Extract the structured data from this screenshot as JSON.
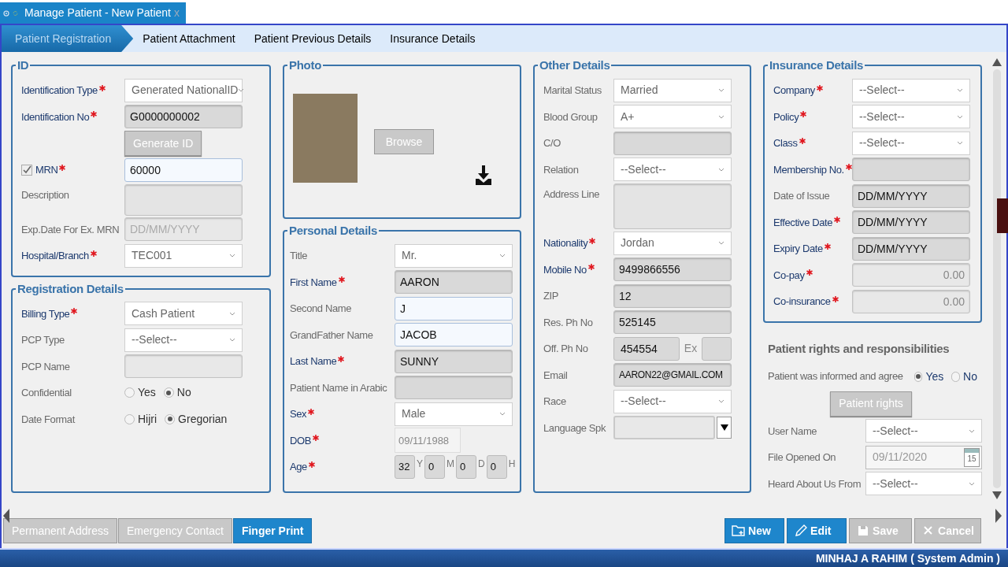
{
  "window_tab": {
    "title": "Manage Patient - New Patient",
    "close": "x"
  },
  "tabs": [
    {
      "label": "Patient Registration",
      "selected": true
    },
    {
      "label": "Patient Attachment",
      "selected": false
    },
    {
      "label": "Patient Previous Details",
      "selected": false
    },
    {
      "label": "Insurance Details",
      "selected": false
    }
  ],
  "columns": [
    [
      {
        "kind": "fieldset",
        "legend": "ID",
        "rows": [
          {
            "kind": "select",
            "label": "Identification Type",
            "required": true,
            "value": "Generated NationalID"
          },
          {
            "kind": "filled",
            "label": "Identification No",
            "required": true,
            "value": "G0000000002"
          },
          {
            "kind": "button",
            "label": "Generate ID"
          },
          {
            "kind": "editable",
            "label": "MRN",
            "required": true,
            "checked": true,
            "value": "60000"
          },
          {
            "kind": "textarea",
            "label": "Description",
            "required": false
          },
          {
            "kind": "disabled",
            "label": "Exp.Date For Ex. MRN",
            "required": false,
            "placeholder": "DD/MM/YYYY"
          },
          {
            "kind": "select",
            "label": "Hospital/Branch",
            "required": true,
            "value": "TEC001"
          }
        ]
      },
      {
        "kind": "fieldset",
        "legend": "Registration Details",
        "rows": [
          {
            "kind": "select",
            "label": "Billing Type",
            "required": true,
            "value": "Cash Patient"
          },
          {
            "kind": "select",
            "label": "PCP Type",
            "required": false,
            "value": "--Select--"
          },
          {
            "kind": "disabled",
            "label": "PCP Name",
            "required": false
          },
          {
            "kind": "radio",
            "label": "Confidential",
            "required": false,
            "options": [
              {
                "label": "Yes",
                "selected": false
              },
              {
                "label": "No",
                "selected": true
              }
            ]
          },
          {
            "kind": "radio",
            "label": "Date Format",
            "required": false,
            "options": [
              {
                "label": "Hijri",
                "selected": false
              },
              {
                "label": "Gregorian",
                "selected": true
              }
            ]
          }
        ]
      }
    ],
    [
      {
        "kind": "photo",
        "legend": "Photo",
        "browse": "Browse"
      },
      {
        "kind": "fieldset",
        "legend": "Personal Details",
        "rows": [
          {
            "kind": "select",
            "label": "Title",
            "required": false,
            "value": "Mr."
          },
          {
            "kind": "filled",
            "label": "First Name",
            "required": true,
            "value": "AARON"
          },
          {
            "kind": "editable",
            "label": "Second Name",
            "required": false,
            "value": "J"
          },
          {
            "kind": "editable",
            "label": "GrandFather Name",
            "required": false,
            "value": "JACOB"
          },
          {
            "kind": "filled",
            "label": "Last Name",
            "required": true,
            "value": "SUNNY"
          },
          {
            "kind": "filled",
            "label": "Patient Name in Arabic",
            "required": false
          },
          {
            "kind": "select",
            "label": "Sex",
            "required": true,
            "value": "Male"
          },
          {
            "kind": "date",
            "label": "DOB",
            "required": true,
            "value": "09/11/1988"
          },
          {
            "kind": "age",
            "label": "Age",
            "required": true,
            "parts": [
              {
                "value": "32",
                "unit": "Y"
              },
              {
                "value": "0",
                "unit": "M"
              },
              {
                "value": "0",
                "unit": "D"
              },
              {
                "value": "0",
                "unit": "H"
              }
            ]
          }
        ]
      }
    ],
    [
      {
        "kind": "fieldset",
        "legend": "Other Details",
        "rows": [
          {
            "kind": "select",
            "label": "Marital Status",
            "required": false,
            "value": "Married"
          },
          {
            "kind": "select",
            "label": "Blood Group",
            "required": false,
            "value": "A+"
          },
          {
            "kind": "filled",
            "label": "C/O",
            "required": false
          },
          {
            "kind": "select",
            "label": "Relation",
            "required": false,
            "value": "--Select--"
          },
          {
            "kind": "textarea",
            "label": "Address Line",
            "required": false
          },
          {
            "kind": "select",
            "label": "Nationality",
            "required": true,
            "value": "Jordan"
          },
          {
            "kind": "filled",
            "label": "Mobile No",
            "required": true,
            "value": "9499866556"
          },
          {
            "kind": "filled",
            "label": "ZIP",
            "required": false,
            "value": "12"
          },
          {
            "kind": "filled",
            "label": "Res. Ph No",
            "required": false,
            "value": "525145"
          },
          {
            "kind": "phone",
            "label": "Off. Ph No",
            "required": false,
            "value": "454554",
            "ext_label": "Ex"
          },
          {
            "kind": "email",
            "label": "Email",
            "required": false,
            "value": "AARON22@GMAIL.COM"
          },
          {
            "kind": "select",
            "label": "Race",
            "required": false,
            "value": "--Select--"
          },
          {
            "kind": "combo",
            "label": "Language Spk",
            "required": false
          }
        ]
      }
    ],
    [
      {
        "kind": "fieldset",
        "legend": "Insurance Details",
        "rows": [
          {
            "kind": "select",
            "label": "Company",
            "required": true,
            "value": "--Select--"
          },
          {
            "kind": "select",
            "label": "Policy",
            "required": true,
            "value": "--Select--"
          },
          {
            "kind": "select",
            "label": "Class",
            "required": true,
            "value": "--Select--"
          },
          {
            "kind": "filled",
            "label": "Membership No.",
            "required": true
          },
          {
            "kind": "filled",
            "label": "Date of Issue",
            "required": false,
            "value": "DD/MM/YYYY"
          },
          {
            "kind": "filled",
            "label": "Effective Date",
            "required": true,
            "value": "DD/MM/YYYY"
          },
          {
            "kind": "filled",
            "label": "Expiry Date",
            "required": true,
            "value": "DD/MM/YYYY"
          },
          {
            "kind": "number",
            "label": "Co-pay",
            "required": true,
            "value": "0.00"
          },
          {
            "kind": "number",
            "label": "Co-insurance",
            "required": true,
            "value": "0.00"
          }
        ]
      },
      {
        "kind": "plain",
        "heading": "Patient rights and responsibilities",
        "rows": [
          {
            "kind": "radio",
            "label": "Patient was informed and agree",
            "required": false,
            "options": [
              {
                "label": "Yes",
                "selected": true
              },
              {
                "label": "No",
                "selected": false
              }
            ]
          },
          {
            "kind": "button",
            "label": "Patient rights"
          },
          {
            "kind": "select",
            "label": "User Name",
            "required": false,
            "value": "--Select--"
          },
          {
            "kind": "calendar",
            "label": "File Opened On",
            "required": false,
            "value": "09/11/2020",
            "day": "15"
          },
          {
            "kind": "select",
            "label": "Heard About Us From",
            "required": false,
            "value": "--Select--"
          }
        ]
      }
    ]
  ],
  "bottom_tabs": [
    {
      "label": "Permanent Address",
      "selected": false
    },
    {
      "label": "Emergency Contact",
      "selected": false
    },
    {
      "label": "Finger Print",
      "selected": true
    }
  ],
  "actions": [
    {
      "kind": "new",
      "label": "New",
      "disabled": false
    },
    {
      "kind": "edit",
      "label": "Edit",
      "disabled": false
    },
    {
      "kind": "save",
      "label": "Save",
      "disabled": true
    },
    {
      "kind": "cancel",
      "label": "Cancel",
      "disabled": true
    }
  ],
  "status_bar": {
    "user": "MINHAJ A RAHIM ( System Admin )"
  }
}
